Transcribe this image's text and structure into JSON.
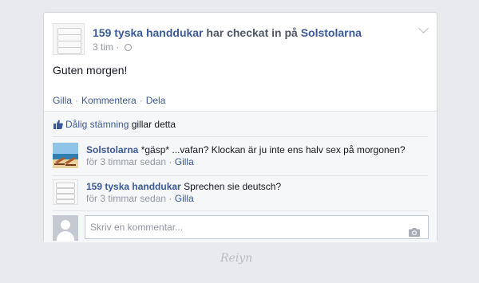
{
  "post": {
    "page_name": "159 tyska handdukar",
    "checkin_text": "har checkat in på",
    "place_name": "Solstolarna",
    "time": "3 tim",
    "separator": "·",
    "body_text": "Guten morgen!",
    "icons": {
      "privacy": "globe-icon",
      "menu": "chevron-down-icon",
      "avatar": "towel-stack-avatar"
    }
  },
  "actions": {
    "like": "Gilla",
    "comment": "Kommentera",
    "share": "Dela",
    "separator": "·"
  },
  "likes": {
    "liker": "Dålig stämning",
    "suffix": "gillar detta",
    "icon": "thumbs-up-icon"
  },
  "comments": [
    {
      "author": "Solstolarna",
      "text": "*gäsp* ...vafan? Klockan är ju inte ens halv sex på morgonen?",
      "time": "för 3 timmar sedan",
      "separator": "·",
      "like_label": "Gilla",
      "avatar": "beach-chairs-avatar"
    },
    {
      "author": "159 tyska handdukar",
      "text": "Sprechen sie deutsch?",
      "time": "för 3 timmar sedan",
      "separator": "·",
      "like_label": "Gilla",
      "avatar": "towel-stack-avatar"
    }
  ],
  "composer": {
    "placeholder": "Skriv en kommentar...",
    "icon": "camera-icon"
  },
  "watermark": "Reiyn",
  "colors": {
    "link": "#3b5998",
    "meta": "#9197a3",
    "background": "#e9eaed"
  }
}
